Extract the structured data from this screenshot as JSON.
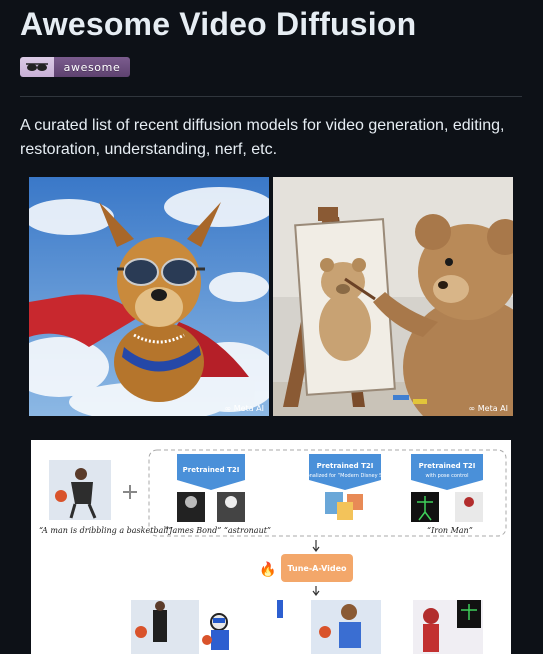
{
  "header": {
    "title": "Awesome Video Diffusion",
    "badge_label": "awesome"
  },
  "description": "A curated list of recent diffusion models for video generation, editing, restoration, understanding, nerf, etc.",
  "images": {
    "dog_watermark": "∞ Meta AI",
    "bear_watermark": "∞ Meta AI"
  },
  "diagram": {
    "input_caption": "“A man is dribbling a basketball”",
    "pretrained_t2i": "Pretrained T2I",
    "pretrained_t2i_personalized": "Pretrained T2I",
    "personalized_sub": "personalized for “Modern Disney Style”",
    "pretrained_t2i_pose": "Pretrained T2I",
    "pose_sub": "with pose control",
    "caption_james": "“James Bond” “astronaut”",
    "caption_ironman": "“Iron Man”",
    "tune_label": "Tune-A-Video",
    "fire_icon": "🔥"
  },
  "colors": {
    "background": "#0d1117",
    "text": "#e6edf3",
    "divider": "#30363d",
    "diagram_blue": "#4a90d9",
    "diagram_orange": "#f3a76a"
  }
}
